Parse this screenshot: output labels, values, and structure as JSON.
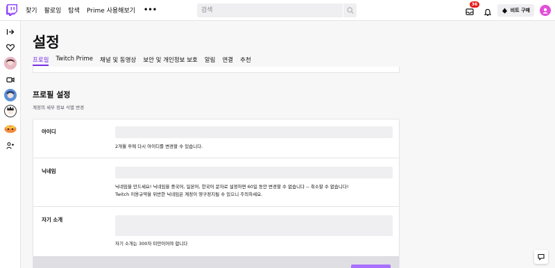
{
  "topnav": {
    "links": [
      "찾기",
      "팔로잉",
      "탐색",
      "Prime 사용해보기"
    ],
    "more": "•••",
    "search_placeholder": "검색",
    "inbox_count": "36",
    "bits_label": "비트 구매"
  },
  "sidebar": {
    "icons": [
      "collapse-arrow-icon",
      "heart-icon",
      "channel-avatar",
      "video-camera-icon",
      "channel-avatar",
      "channel-avatar",
      "channel-avatar",
      "friends-icon"
    ]
  },
  "page": {
    "title": "설정",
    "tabs": [
      "프로필",
      "Twitch Prime",
      "채널 및 동영상",
      "보안 및 개인정보 보호",
      "알림",
      "연결",
      "추천"
    ],
    "active_tab": 0
  },
  "profile_settings": {
    "title": "프로필 설정",
    "subtitle": "계정의 세부 정보 식별 변경",
    "username": {
      "label": "아이디",
      "help": "2개월 후에 다시 아이디를 변경할 수 있습니다."
    },
    "display_name": {
      "label": "닉네임",
      "help_line1": "닉네임을 만드세요! 닉네임을 중국어, 일본어, 한국어 문자로 설정하면 60일 동안 변경할 수 없습니다 -- 취소할 수 없습니다!",
      "help_line2": "Twitch 이용규약을 위반한 닉네임은 계정이 영구정지될 수 있으니 주의하세요."
    },
    "bio": {
      "label": "자기 소개",
      "help": "자기 소개는 300자 미만이어야 합니다"
    }
  },
  "colors": {
    "accent": "#772ce8",
    "accent_light": "#a970ff",
    "badge": "#e91916",
    "input_bg": "#efeff1"
  }
}
